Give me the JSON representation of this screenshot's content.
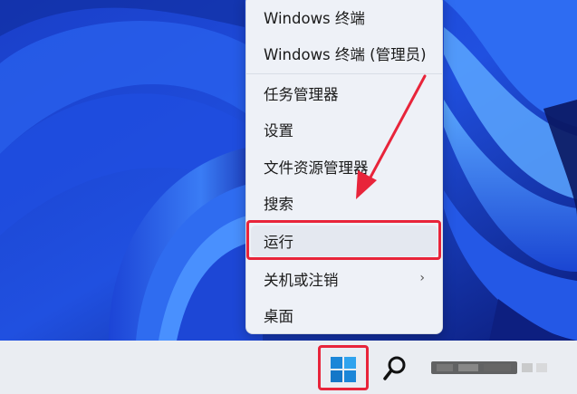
{
  "context_menu": {
    "items": [
      {
        "label": "Windows 终端"
      },
      {
        "label": "Windows 终端 (管理员)"
      },
      {
        "label": "任务管理器"
      },
      {
        "label": "设置"
      },
      {
        "label": "文件资源管理器"
      },
      {
        "label": "搜索"
      },
      {
        "label": "运行"
      },
      {
        "label": "关机或注销",
        "chevron": "›"
      },
      {
        "label": "桌面"
      }
    ]
  },
  "colors": {
    "highlight": "#e8243a",
    "desktop_blue": "#1f4bd1",
    "taskbar": "#eaedf2",
    "windows_logo": "#1b86d8"
  },
  "taskbar": {
    "icons": [
      "windows-logo-icon",
      "search-icon",
      "blurred-app-icon"
    ]
  }
}
